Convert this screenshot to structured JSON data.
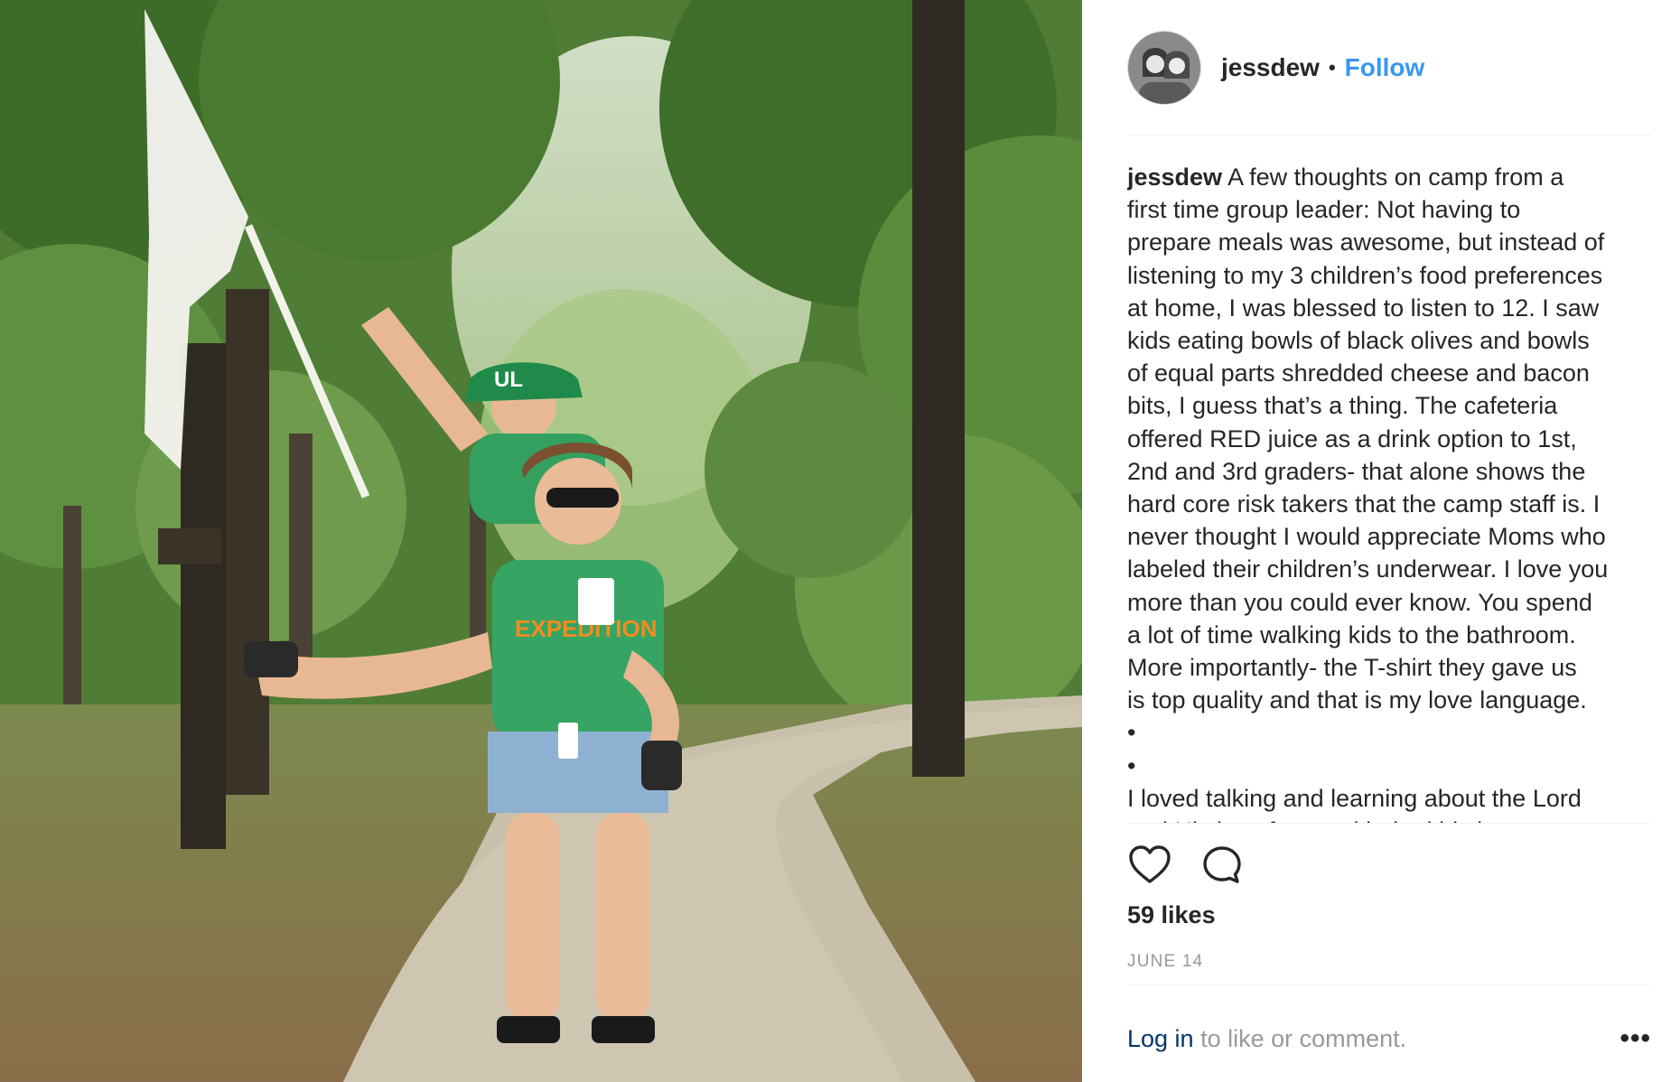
{
  "header": {
    "username": "jessdew",
    "separator": "•",
    "follow_label": "Follow"
  },
  "caption": {
    "username": "jessdew",
    "lines": [
      "A few thoughts on camp from a",
      "first time group leader: Not having to",
      "prepare meals was awesome, but instead of",
      "listening to my 3 children’s food preferences",
      "at home, I was blessed to listen to 12. I saw",
      "kids eating bowls of black olives and bowls",
      "of equal parts shredded cheese and bacon",
      "bits, I guess that’s a thing. The cafeteria",
      "offered RED juice as a drink option to 1st,",
      "2nd and 3rd graders- that alone shows the",
      "hard core risk takers that the camp staff is. I",
      "never thought I would appreciate Moms who",
      "labeled their children’s underwear. I love you",
      "more than you could ever know. You spend",
      "a lot of time walking kids to the bathroom.",
      "More importantly- the T-shirt they gave us",
      "is top quality and that is my love language.",
      "•",
      "•",
      "I loved talking and learning about the Lord",
      "and His love for us with the kids but"
    ]
  },
  "actions": {
    "like_icon": "heart-icon",
    "comment_icon": "comment-icon"
  },
  "likes": "59 likes",
  "date": "JUNE 14",
  "footer": {
    "login_label": "Log in",
    "rest_text": " to like or comment.",
    "more_label": "•••"
  },
  "photo": {
    "cap_text": "UL",
    "shirt_text": "EXPEDITION"
  },
  "colors": {
    "follow_blue": "#3897f0",
    "login_blue": "#003569",
    "text": "#262626",
    "muted": "#999999",
    "divider": "#efefef"
  }
}
